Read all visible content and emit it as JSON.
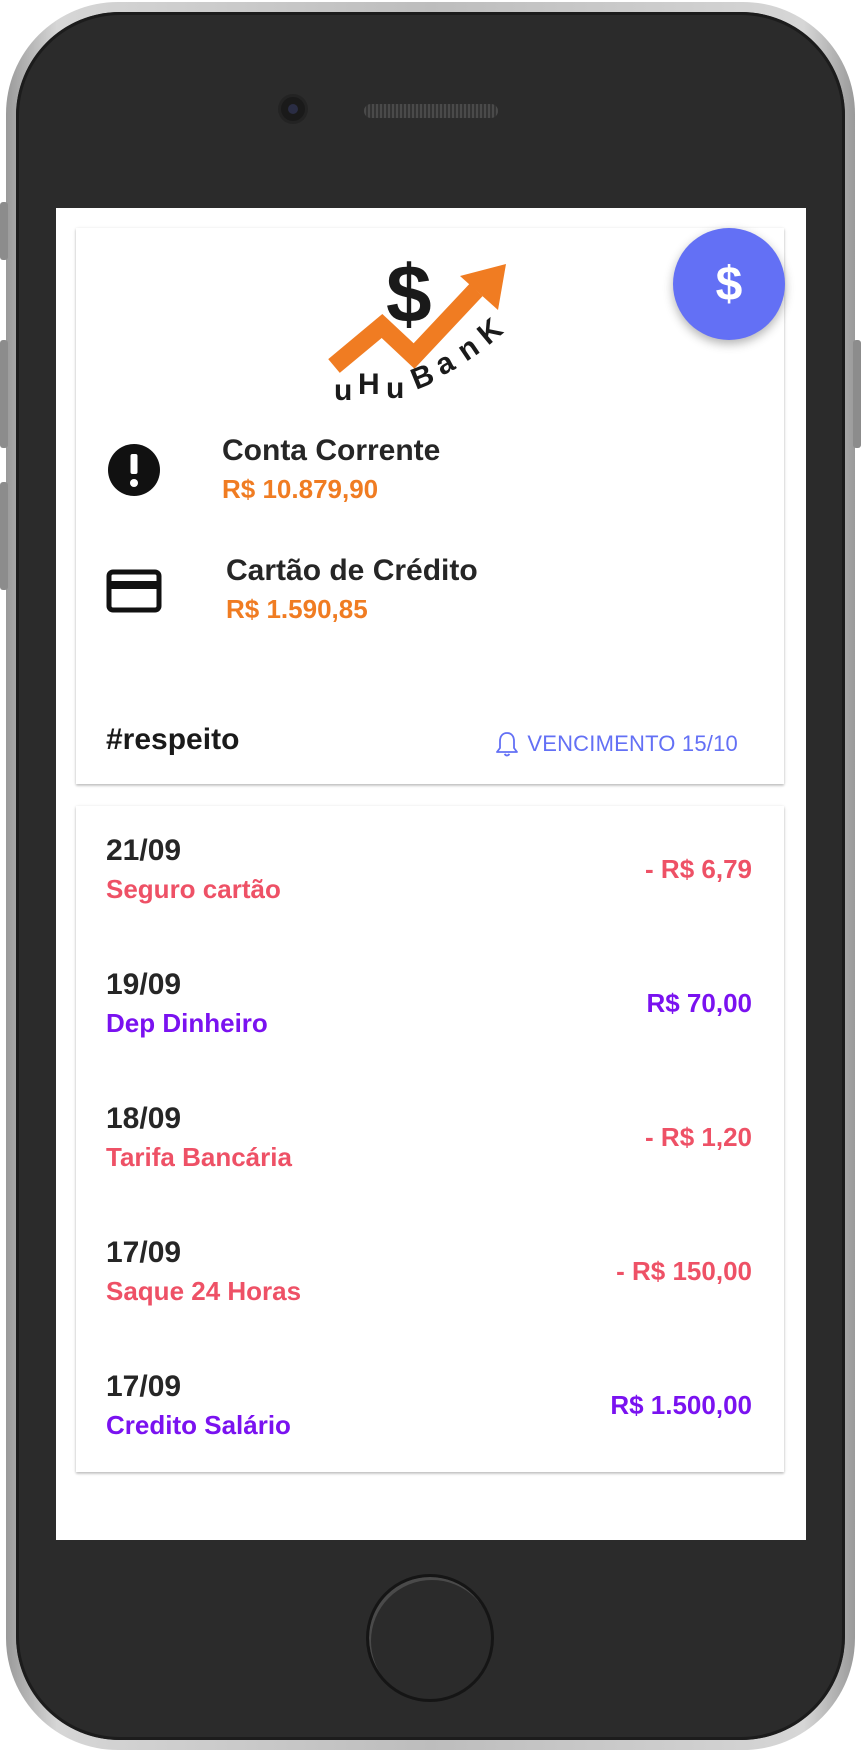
{
  "brand": {
    "logo_letters": [
      "u",
      "H",
      "u",
      "B",
      "a",
      "n",
      "K"
    ],
    "logo_symbol": "$",
    "logo_colors": {
      "arrow": "#f07c22",
      "text": "#1a1a1a"
    }
  },
  "fab": {
    "label": "$",
    "color": "#6370f5"
  },
  "accounts": [
    {
      "name": "Conta Corrente",
      "value": "R$ 10.879,90",
      "icon": "exclamation-circle-icon"
    },
    {
      "name": "Cartão de Crédito",
      "value": "R$ 1.590,85",
      "icon": "credit-card-icon"
    }
  ],
  "footer": {
    "tag": "#respeito",
    "due_label": "VENCIMENTO 15/10",
    "due_icon": "bell-icon"
  },
  "transactions": [
    {
      "date": "21/09",
      "description": "Seguro cartão",
      "amount": "- R$ 6,79",
      "kind": "debit"
    },
    {
      "date": "19/09",
      "description": "Dep Dinheiro",
      "amount": "R$ 70,00",
      "kind": "credit"
    },
    {
      "date": "18/09",
      "description": "Tarifa Bancária",
      "amount": "- R$ 1,20",
      "kind": "debit"
    },
    {
      "date": "17/09",
      "description": "Saque 24 Horas",
      "amount": "- R$ 150,00",
      "kind": "debit"
    },
    {
      "date": "17/09",
      "description": "Credito Salário",
      "amount": "R$ 1.500,00",
      "kind": "credit"
    }
  ],
  "colors": {
    "accent": "#6370f5",
    "balance": "#f07c22",
    "debit": "#ee5166",
    "credit": "#7a12f0"
  }
}
